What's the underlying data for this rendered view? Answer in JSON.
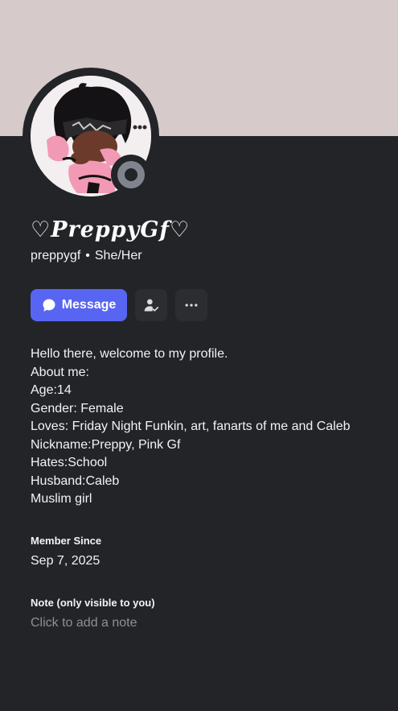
{
  "profile": {
    "display_name": "♡PreppyGf♡",
    "username": "preppygf",
    "separator": "•",
    "pronouns": "She/Her",
    "status": "offline"
  },
  "actions": {
    "message_label": "Message",
    "friend_icon": "add-friend-icon",
    "more_icon": "more-horizontal-icon"
  },
  "bio": {
    "lines": [
      "Hello there, welcome to my profile.",
      "About me:",
      "Age:14",
      "Gender: Female",
      "Loves: Friday Night Funkin, art, fanarts of me and Caleb",
      "Nickname:Preppy, Pink Gf",
      "Hates:School",
      "Husband:Caleb",
      "Muslim girl"
    ]
  },
  "member_since": {
    "label": "Member Since",
    "value": "Sep 7, 2025"
  },
  "note": {
    "label": "Note (only visible to you)",
    "placeholder": "Click to add a note"
  },
  "colors": {
    "banner": "#d6cacb",
    "background": "#232428",
    "accent": "#5865f2",
    "status_offline": "#80848e"
  }
}
